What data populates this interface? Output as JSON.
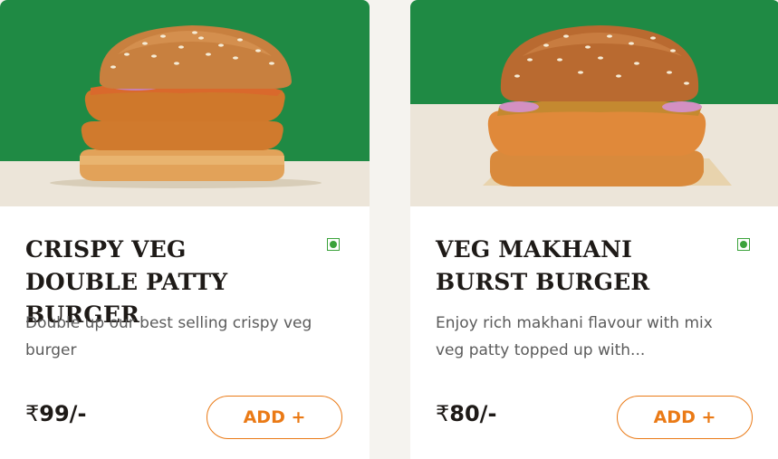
{
  "theme": {
    "brand_orange": "#ea7a16",
    "brand_green": "#1f8a44",
    "floor_cream": "#ece5d9",
    "veg_green": "#3aa23a"
  },
  "products": [
    {
      "title": "CRISPY VEG DOUBLE PATTY BURGER",
      "description": "Double up our best selling crispy veg burger",
      "currency": "₹",
      "price": "99/-",
      "add_label": "ADD +",
      "diet_icon": "veg-indicator-icon",
      "image": "double-patty-burger-image"
    },
    {
      "title": "VEG MAKHANI BURST BURGER",
      "description": "Enjoy rich makhani flavour with mix veg patty topped up with...",
      "currency": "₹",
      "price": "80/-",
      "add_label": "ADD +",
      "diet_icon": "veg-indicator-icon",
      "image": "makhani-burger-image"
    }
  ]
}
